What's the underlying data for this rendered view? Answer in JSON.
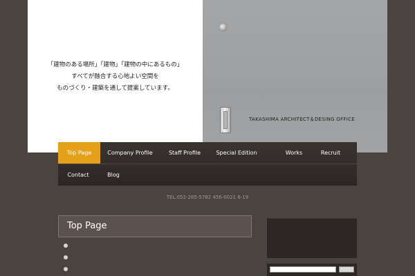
{
  "hero": {
    "tagline": [
      "「建物のある場所」「建物」「建物の中にあるもの」",
      "すべてが融合する心地よい空間を",
      "ものづくり・建築を通して提案しています。"
    ],
    "office_name": "TAKASHIMA ARCHITECT＆DESING OFFICE"
  },
  "nav": {
    "row1": [
      "Top Page",
      "Company Profile",
      "Staff Profile",
      "Special Edition",
      "Works",
      "Recruit"
    ],
    "row2": [
      "Contact",
      "Blog"
    ],
    "active": "Top Page"
  },
  "contact": {
    "tel": "TEL.052-265-5782 456-0021 6-19"
  },
  "main": {
    "heading": "Top Page",
    "bullet_count": 3
  },
  "colors": {
    "background": "#4a4340",
    "nav_active": "#e6a11a",
    "nav_bg": "#2f2a28"
  },
  "icons": [
    "door-knob-icon",
    "door-handle-icon",
    "bullet-icon"
  ]
}
